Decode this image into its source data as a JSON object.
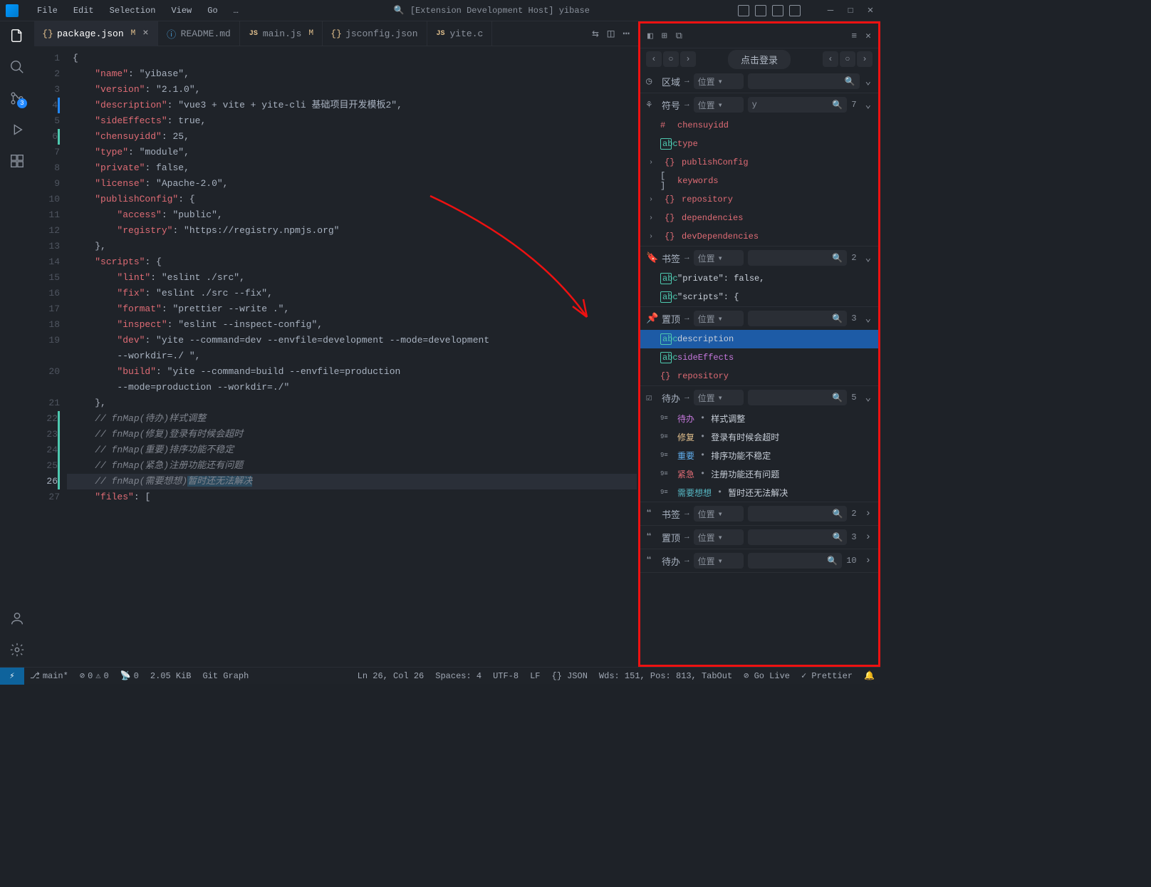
{
  "menu": {
    "file": "File",
    "edit": "Edit",
    "selection": "Selection",
    "view": "View",
    "go": "Go",
    "more": "…"
  },
  "title": {
    "search": "🔍",
    "text": "[Extension Development Host] yibase"
  },
  "activity": {
    "badge": "3"
  },
  "tabs": {
    "items": [
      {
        "icon": "{}",
        "label": "package.json",
        "m": "M",
        "active": true
      },
      {
        "icon": "ⓘ",
        "label": "README.md"
      },
      {
        "icon": "JS",
        "label": "main.js",
        "m": "M"
      },
      {
        "icon": "{}",
        "label": "jsconfig.json"
      },
      {
        "icon": "JS",
        "label": "yite.c"
      }
    ]
  },
  "code": {
    "lines": [
      "{",
      "    \"name\": \"yibase\",",
      "    \"version\": \"2.1.0\",",
      "    \"description\": \"vue3 + vite + yite-cli 基础项目开发模板2\",",
      "    \"sideEffects\": true,",
      "    \"chensuyidd\": 25,",
      "    \"type\": \"module\",",
      "    \"private\": false,",
      "    \"license\": \"Apache-2.0\",",
      "    \"publishConfig\": {",
      "        \"access\": \"public\",",
      "        \"registry\": \"https://registry.npmjs.org\"",
      "    },",
      "    \"scripts\": {",
      "        \"lint\": \"eslint ./src\",",
      "        \"fix\": \"eslint ./src --fix\",",
      "        \"format\": \"prettier --write .\",",
      "        \"inspect\": \"eslint --inspect-config\",",
      "        \"dev\": \"yite --command=dev --envfile=development --mode=development --workdir=./ \",",
      "        \"build\": \"yite --command=build --envfile=production --mode=production --workdir=./\"",
      "    },",
      "    // fnMap(待办)样式调整",
      "    // fnMap(修复)登录有时候会超时",
      "    // fnMap(重要)排序功能不稳定",
      "    // fnMap(紧急)注册功能还有问题",
      "    // fnMap(需要想想)暂时还无法解决",
      "    \"files\": ["
    ]
  },
  "panel": {
    "login": "点击登录",
    "region": {
      "label": "区域",
      "filter": "位置"
    },
    "symbol": {
      "label": "符号",
      "filter": "位置",
      "query": "y",
      "count": "7",
      "items": [
        {
          "ico": "hash",
          "txt": "chensuyidd"
        },
        {
          "ico": "abc",
          "txt": "type"
        },
        {
          "ico": "brace",
          "txt": "publishConfig",
          "chev": true
        },
        {
          "ico": "brack",
          "txt": "keywords"
        },
        {
          "ico": "brace",
          "txt": "repository",
          "chev": true
        },
        {
          "ico": "brace",
          "txt": "dependencies",
          "chev": true
        },
        {
          "ico": "brace",
          "txt": "devDependencies",
          "chev": true
        }
      ]
    },
    "bookmark": {
      "label": "书签",
      "filter": "位置",
      "count": "2",
      "items": [
        {
          "ico": "abc",
          "txt": "\"private\": false,"
        },
        {
          "ico": "abc",
          "txt": "\"scripts\": {"
        }
      ]
    },
    "pin": {
      "label": "置顶",
      "filter": "位置",
      "count": "3",
      "items": [
        {
          "ico": "abc",
          "txt": "description",
          "sel": true
        },
        {
          "ico": "abc",
          "txt": "sideEffects",
          "color": "#c678dd"
        },
        {
          "ico": "brace",
          "txt": "repository"
        }
      ]
    },
    "todo": {
      "label": "待办",
      "filter": "位置",
      "count": "5",
      "items": [
        {
          "tag": "待办",
          "txt": "样式调整"
        },
        {
          "tag": "修复",
          "txt": "登录有时候会超时"
        },
        {
          "tag": "重要",
          "txt": "排序功能不稳定"
        },
        {
          "tag": "紧急",
          "txt": "注册功能还有问题"
        },
        {
          "tag": "需要想想",
          "txt": "暂时还无法解决"
        }
      ]
    },
    "bookmark2": {
      "label": "书签",
      "filter": "位置",
      "count": "2"
    },
    "pin2": {
      "label": "置顶",
      "filter": "位置",
      "count": "3"
    },
    "todo2": {
      "label": "待办",
      "filter": "位置",
      "count": "10"
    }
  },
  "status": {
    "branch": "main*",
    "errors": "0",
    "warnings": "0",
    "radio": "0",
    "size": "2.05 KiB",
    "git": "Git Graph",
    "pos": "Ln 26, Col 26",
    "spaces": "Spaces: 4",
    "enc": "UTF-8",
    "eol": "LF",
    "lang": "{} JSON",
    "wds": "Wds: 151, Pos: 813, TabOut",
    "golive": "⊘ Go Live",
    "prettier": "✓ Prettier",
    "bell": "🔔"
  }
}
